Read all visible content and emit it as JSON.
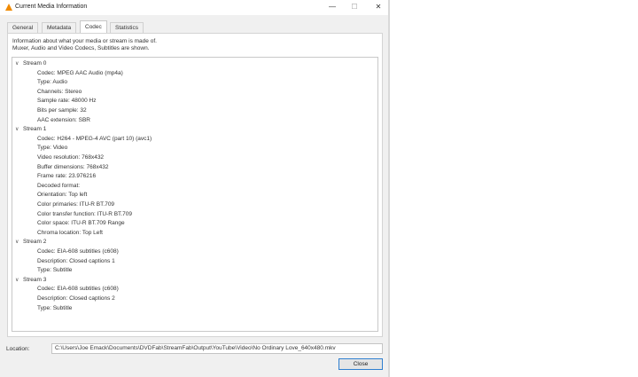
{
  "window": {
    "title": "Current Media Information",
    "controls": {
      "minimize": "—",
      "maximize": "☐",
      "close": "✕"
    }
  },
  "tabs": [
    {
      "label": "General"
    },
    {
      "label": "Metadata"
    },
    {
      "label": "Codec",
      "active": true
    },
    {
      "label": "Statistics"
    }
  ],
  "codec_panel": {
    "info_line1": "Information about what your media or stream is made of.",
    "info_line2": "Muxer, Audio and Video Codecs, Subtitles are shown.",
    "tree": [
      {
        "text": "Stream 0",
        "level": 0,
        "expanded": true
      },
      {
        "text": "Codec: MPEG AAC Audio (mp4a)",
        "level": 1
      },
      {
        "text": "Type: Audio",
        "level": 1
      },
      {
        "text": "Channels: Stereo",
        "level": 1
      },
      {
        "text": "Sample rate: 48000 Hz",
        "level": 1
      },
      {
        "text": "Bits per sample: 32",
        "level": 1
      },
      {
        "text": "AAC extension: SBR",
        "level": 1
      },
      {
        "text": "Stream 1",
        "level": 0,
        "expanded": true
      },
      {
        "text": "Codec: H264 - MPEG-4 AVC (part 10) (avc1)",
        "level": 1
      },
      {
        "text": "Type: Video",
        "level": 1
      },
      {
        "text": "Video resolution: 768x432",
        "level": 1
      },
      {
        "text": "Buffer dimensions: 768x432",
        "level": 1
      },
      {
        "text": "Frame rate: 23.976216",
        "level": 1
      },
      {
        "text": "Decoded format:",
        "level": 1
      },
      {
        "text": "Orientation: Top left",
        "level": 1
      },
      {
        "text": "Color primaries: ITU-R BT.709",
        "level": 1
      },
      {
        "text": "Color transfer function: ITU-R BT.709",
        "level": 1
      },
      {
        "text": "Color space: ITU-R BT.709 Range",
        "level": 1
      },
      {
        "text": "Chroma location: Top Left",
        "level": 1
      },
      {
        "text": "Stream 2",
        "level": 0,
        "expanded": true
      },
      {
        "text": "Codec: EIA-608 subtitles (c608)",
        "level": 1
      },
      {
        "text": "Description: Closed captions 1",
        "level": 1
      },
      {
        "text": "Type: Subtitle",
        "level": 1
      },
      {
        "text": "Stream 3",
        "level": 0,
        "expanded": true
      },
      {
        "text": "Codec: EIA-608 subtitles (c608)",
        "level": 1
      },
      {
        "text": "Description: Closed captions 2",
        "level": 1
      },
      {
        "text": "Type: Subtitle",
        "level": 1
      }
    ]
  },
  "location": {
    "label": "Location:",
    "value": "C:\\Users\\Joe Emack\\Documents\\DVDFab\\StreamFab\\Output\\YouTube\\Video\\No Ordinary Love_640x480.mkv"
  },
  "buttons": {
    "close": "Close"
  },
  "colors": {
    "accent_border": "#2f7fd0",
    "app_icon": "#f08a00",
    "window_bg": "#f0f0f0"
  },
  "icons": {
    "app": "vlc-cone-icon",
    "expand": "chevron-down-icon"
  }
}
